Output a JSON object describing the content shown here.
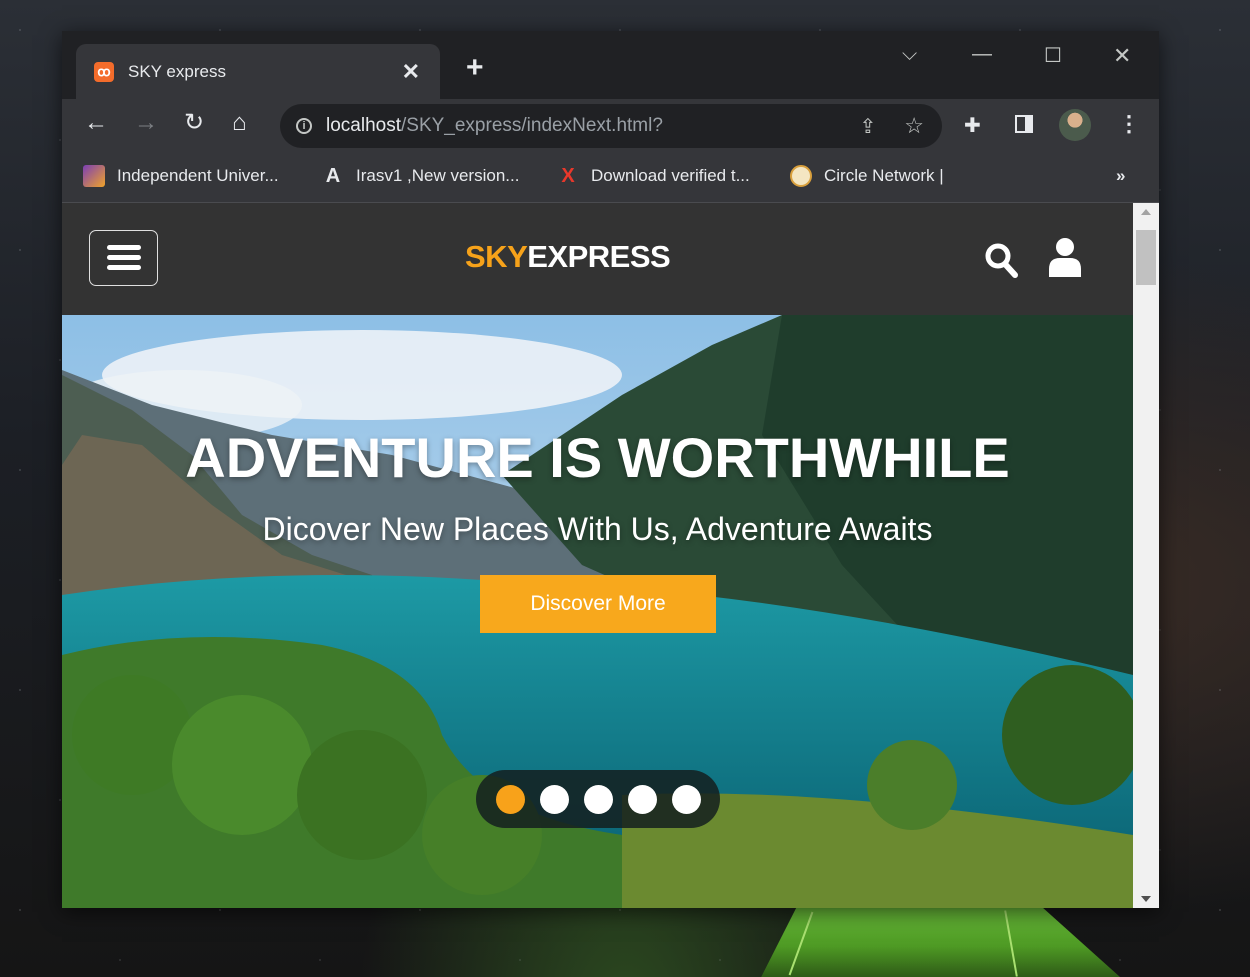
{
  "browser": {
    "tab": {
      "title": "SKY express",
      "favicon": "xampp-icon"
    },
    "url": {
      "host": "localhost",
      "path": "/SKY_express/indexNext.html?"
    },
    "bookmarks": [
      {
        "label": "Independent Univer...",
        "icon": "university-icon"
      },
      {
        "label": "Irasv1 ,New version...",
        "icon": "angular-icon"
      },
      {
        "label": "Download verified t...",
        "icon": "x-icon"
      },
      {
        "label": "Circle Network |",
        "icon": "circle-network-icon"
      }
    ],
    "more_bookmarks": "»"
  },
  "site": {
    "logo_part1": "SKY",
    "logo_part2": "EXPRESS",
    "hero": {
      "title": "ADVENTURE IS WORTHWHILE",
      "subtitle": "Dicover New Places With Us, Adventure Awaits",
      "cta": "Discover More"
    },
    "carousel": {
      "total": 5,
      "active_index": 0
    },
    "accent_color": "#f8a81c"
  }
}
